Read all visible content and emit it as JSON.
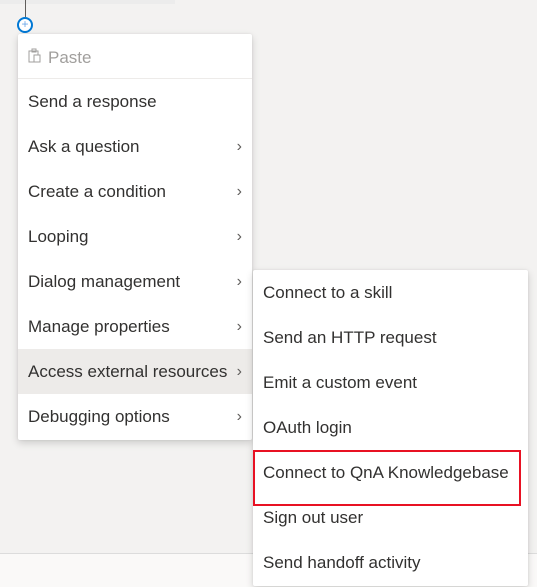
{
  "canvas": {
    "add_node_icon": "plus-circle-icon"
  },
  "main_menu": {
    "paste": {
      "label": "Paste",
      "icon": "clipboard-icon",
      "disabled": true
    },
    "items": [
      {
        "label": "Send a response",
        "has_submenu": false
      },
      {
        "label": "Ask a question",
        "has_submenu": true
      },
      {
        "label": "Create a condition",
        "has_submenu": true
      },
      {
        "label": "Looping",
        "has_submenu": true
      },
      {
        "label": "Dialog management",
        "has_submenu": true
      },
      {
        "label": "Manage properties",
        "has_submenu": true
      },
      {
        "label": "Access external resources",
        "has_submenu": true,
        "active": true
      },
      {
        "label": "Debugging options",
        "has_submenu": true
      }
    ],
    "chevron": "›"
  },
  "sub_menu": {
    "parent": "Access external resources",
    "items": [
      {
        "label": "Connect to a skill"
      },
      {
        "label": "Send an HTTP request"
      },
      {
        "label": "Emit a custom event"
      },
      {
        "label": "OAuth login"
      },
      {
        "label": "Connect to QnA Knowledgebase",
        "highlighted": true
      },
      {
        "label": "Sign out user"
      },
      {
        "label": "Send handoff activity"
      }
    ]
  },
  "colors": {
    "accent": "#0078d4",
    "highlight_border": "#e81123",
    "active_item_bg": "#edebe9"
  }
}
